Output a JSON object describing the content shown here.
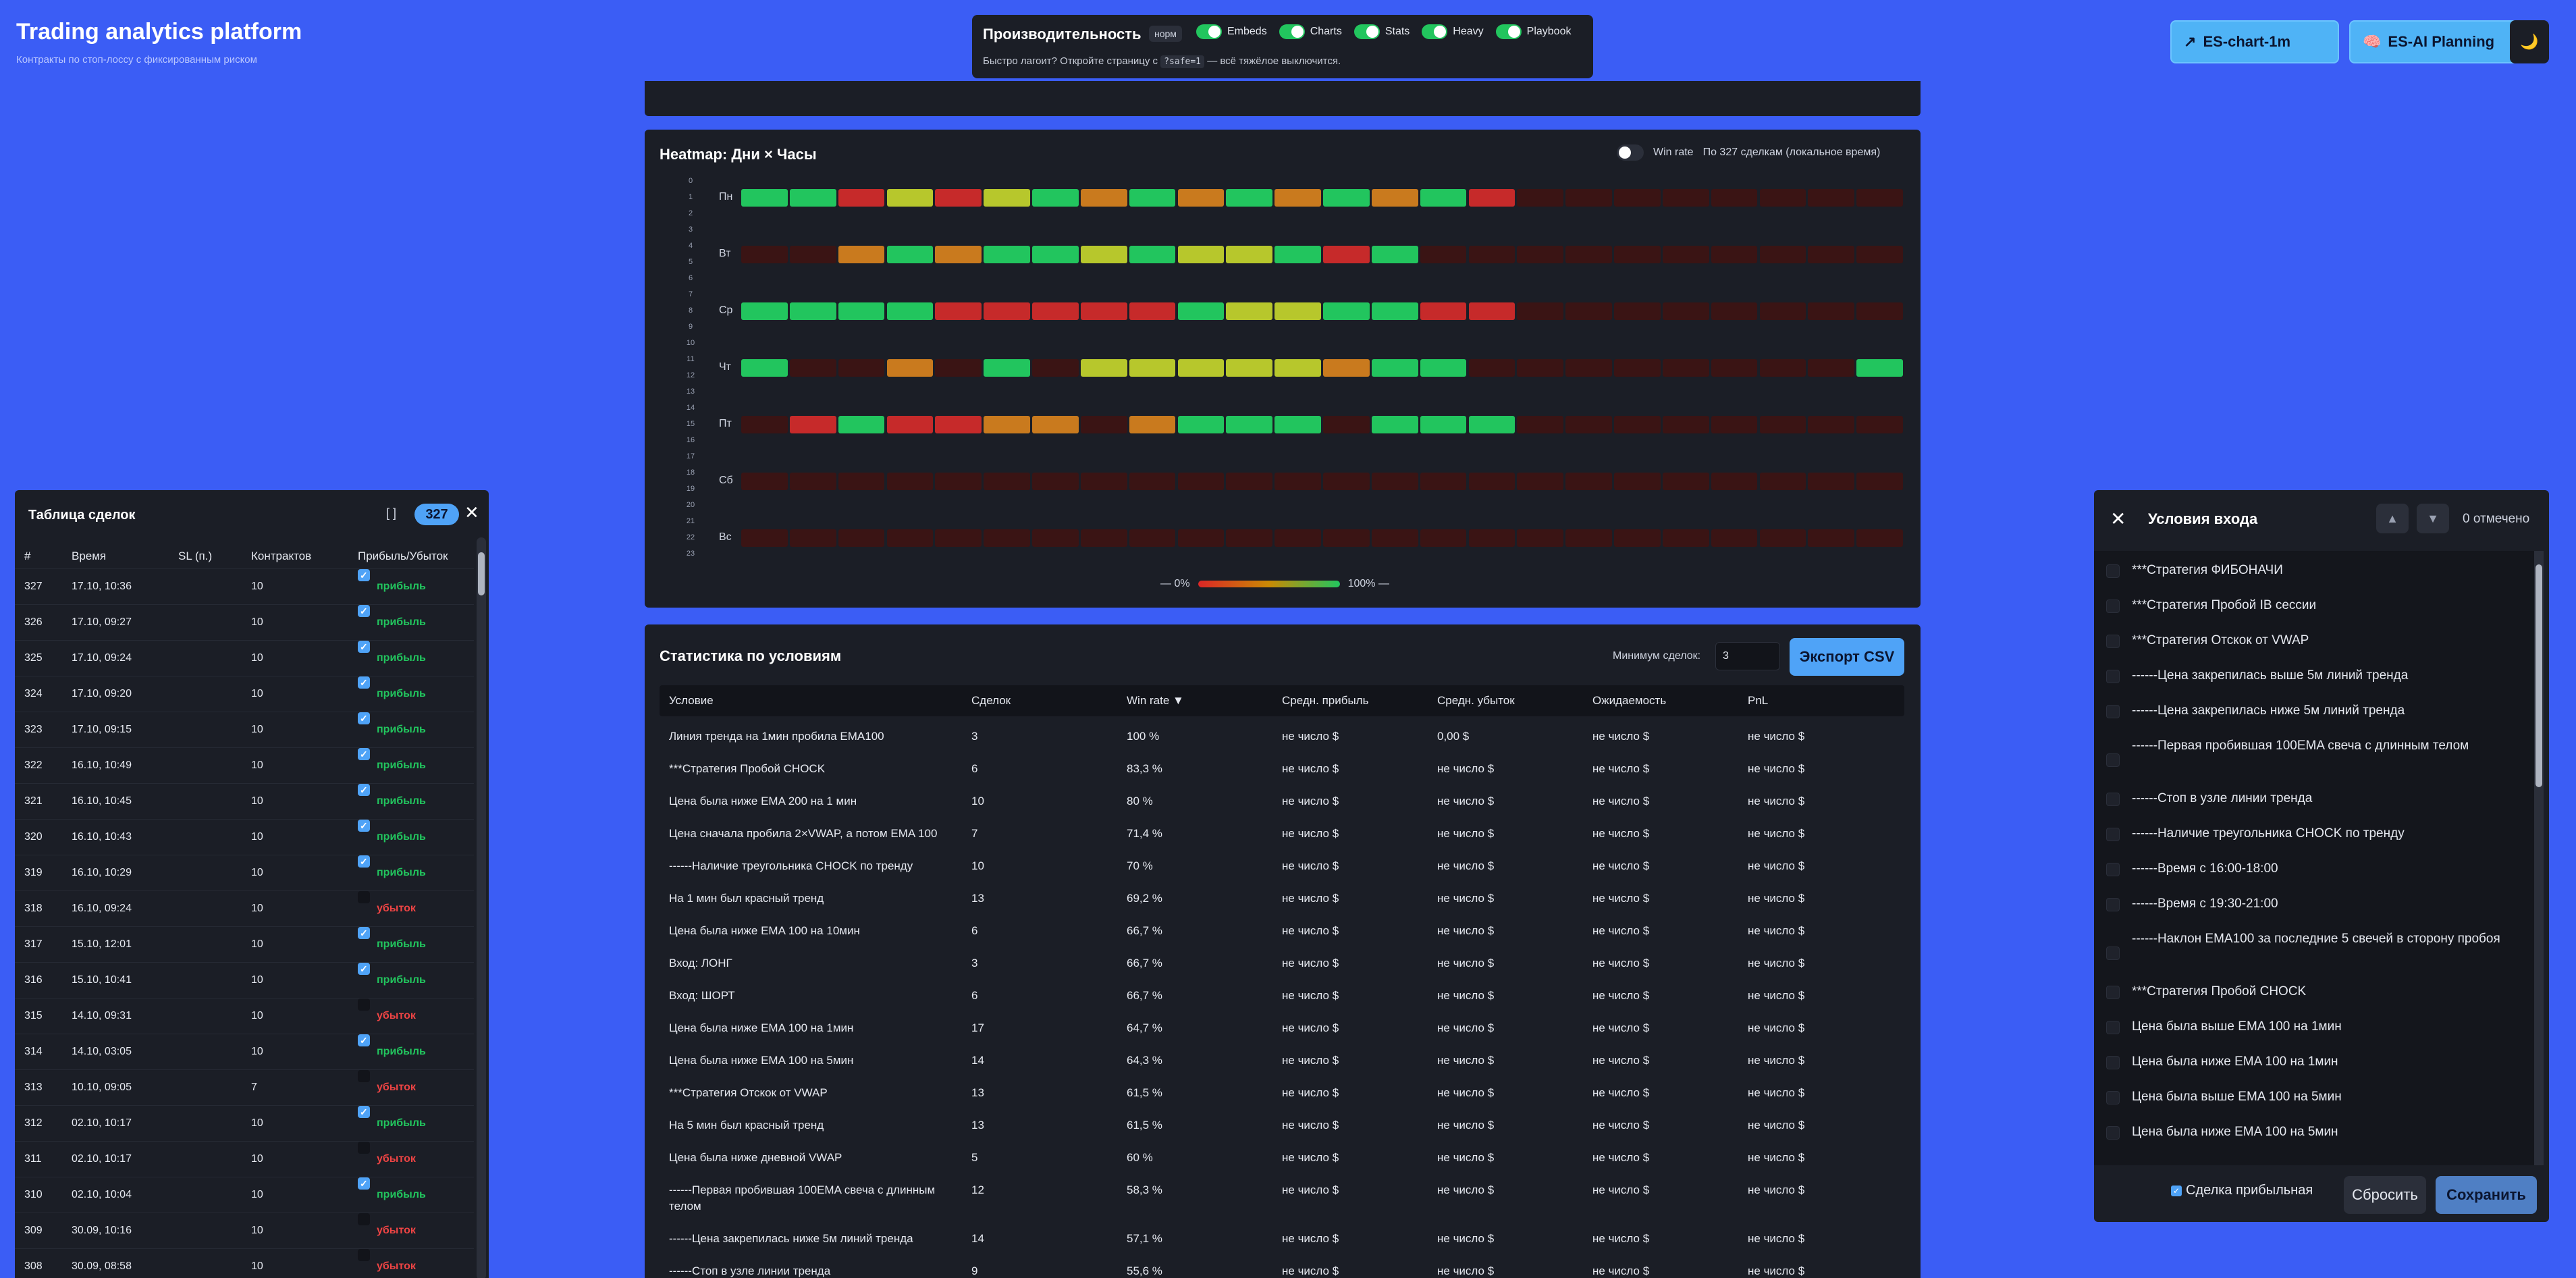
{
  "app": {
    "title": "Trading analytics platform",
    "subtitle": "Контракты по стоп-лоссу с фиксированным риском"
  },
  "perf": {
    "title": "Производительность",
    "badge": "норм",
    "toggles": [
      "Embeds",
      "Charts",
      "Stats",
      "Heavy",
      "Playbook"
    ],
    "hint_a": "Быстро лагоит? Откройте страницу с",
    "hint_code": "?safe=1",
    "hint_b": "— всё тяжёлое выключится."
  },
  "header_buttons": {
    "chart": "ES-chart-1m",
    "ai": "ES-AI Planning",
    "theme_icon": "🌙"
  },
  "colors": {
    "win": "#22c55e",
    "loss": "#ef4444",
    "accent": "#4fa3f7",
    "bg": "#3b5df5",
    "panel": "#1b1e26"
  },
  "heatmap": {
    "title": "Heatmap: Дни × Часы",
    "winrate_label": "Win rate",
    "trades_label": "По 327 сделкам (локальное время)",
    "hours": [
      "0",
      "1",
      "2",
      "3",
      "4",
      "5",
      "6",
      "7",
      "8",
      "9",
      "10",
      "11",
      "12",
      "13",
      "14",
      "15",
      "16",
      "17",
      "18",
      "19",
      "20",
      "21",
      "22",
      "23"
    ],
    "days": [
      "Пн",
      "Вт",
      "Ср",
      "Чт",
      "Пт",
      "Сб",
      "Вс"
    ],
    "cells": [
      "GGRYRYGOGOGOGOGR########",
      "##OGOGGYGYYGRG##########",
      "GGGGRRRRRGYYGGRR########",
      "G##O#G#YYYYYOGG########G",
      "#RGRROO#OGGG#GGG########",
      "########################",
      "########################"
    ],
    "legend_min": "0%",
    "legend_max": "100%"
  },
  "stats": {
    "title": "Статистика по условиям",
    "min_label": "Минимум сделок:",
    "min_value": "3",
    "export_label": "Экспорт CSV",
    "columns": [
      "Условие",
      "Сделок",
      "Win rate ▼",
      "Средн. прибыль",
      "Средн. убыток",
      "Ожидаемость",
      "PnL"
    ],
    "rows": [
      [
        "Линия тренда на 1мин пробила EMA100",
        "3",
        "100 %",
        "не число $",
        "0,00 $",
        "не число $",
        "не число $"
      ],
      [
        "***Стратегия Пробой CHOCK",
        "6",
        "83,3 %",
        "не число $",
        "не число $",
        "не число $",
        "не число $"
      ],
      [
        "Цена была ниже EMA 200 на 1 мин",
        "10",
        "80 %",
        "не число $",
        "не число $",
        "не число $",
        "не число $"
      ],
      [
        "Цена сначала пробила 2×VWAP, а потом EMA 100",
        "7",
        "71,4 %",
        "не число $",
        "не число $",
        "не число $",
        "не число $"
      ],
      [
        "------Наличие треугольника CHOCK по тренду",
        "10",
        "70 %",
        "не число $",
        "не число $",
        "не число $",
        "не число $"
      ],
      [
        "На 1 мин был красный тренд",
        "13",
        "69,2 %",
        "не число $",
        "не число $",
        "не число $",
        "не число $"
      ],
      [
        "Цена была ниже EMA 100 на 10мин",
        "6",
        "66,7 %",
        "не число $",
        "не число $",
        "не число $",
        "не число $"
      ],
      [
        "Вход: ЛОНГ",
        "3",
        "66,7 %",
        "не число $",
        "не число $",
        "не число $",
        "не число $"
      ],
      [
        "Вход: ШОРТ",
        "6",
        "66,7 %",
        "не число $",
        "не число $",
        "не число $",
        "не число $"
      ],
      [
        "Цена была ниже EMA 100 на 1мин",
        "17",
        "64,7 %",
        "не число $",
        "не число $",
        "не число $",
        "не число $"
      ],
      [
        "Цена была ниже EMA 100 на 5мин",
        "14",
        "64,3 %",
        "не число $",
        "не число $",
        "не число $",
        "не число $"
      ],
      [
        "***Стратегия Отскок от VWAP",
        "13",
        "61,5 %",
        "не число $",
        "не число $",
        "не число $",
        "не число $"
      ],
      [
        "На 5 мин был красный тренд",
        "13",
        "61,5 %",
        "не число $",
        "не число $",
        "не число $",
        "не число $"
      ],
      [
        "Цена была ниже дневной VWAP",
        "5",
        "60 %",
        "не число $",
        "не число $",
        "не число $",
        "не число $"
      ],
      [
        "------Первая пробившая 100EMA свеча с длинным телом",
        "12",
        "58,3 %",
        "не число $",
        "не число $",
        "не число $",
        "не число $"
      ],
      [
        "------Цена закрепилась ниже 5м линий тренда",
        "14",
        "57,1 %",
        "не число $",
        "не число $",
        "не число $",
        "не число $"
      ],
      [
        "------Стоп в узле линии тренда",
        "9",
        "55,6 %",
        "не число $",
        "не число $",
        "не число $",
        "не число $"
      ]
    ]
  },
  "trades": {
    "title": "Таблица сделок",
    "brackets": "[ ]",
    "count": "327",
    "columns": [
      "#",
      "Время",
      "SL (п.)",
      "Контрактов",
      "Прибыль/Убыток"
    ],
    "rows": [
      {
        "n": "327",
        "t": "17.10, 10:36",
        "sl": "",
        "c": "10",
        "w": true,
        "r": "прибыль"
      },
      {
        "n": "326",
        "t": "17.10, 09:27",
        "sl": "",
        "c": "10",
        "w": true,
        "r": "прибыль"
      },
      {
        "n": "325",
        "t": "17.10, 09:24",
        "sl": "",
        "c": "10",
        "w": true,
        "r": "прибыль"
      },
      {
        "n": "324",
        "t": "17.10, 09:20",
        "sl": "",
        "c": "10",
        "w": true,
        "r": "прибыль"
      },
      {
        "n": "323",
        "t": "17.10, 09:15",
        "sl": "",
        "c": "10",
        "w": true,
        "r": "прибыль"
      },
      {
        "n": "322",
        "t": "16.10, 10:49",
        "sl": "",
        "c": "10",
        "w": true,
        "r": "прибыль"
      },
      {
        "n": "321",
        "t": "16.10, 10:45",
        "sl": "",
        "c": "10",
        "w": true,
        "r": "прибыль"
      },
      {
        "n": "320",
        "t": "16.10, 10:43",
        "sl": "",
        "c": "10",
        "w": true,
        "r": "прибыль"
      },
      {
        "n": "319",
        "t": "16.10, 10:29",
        "sl": "",
        "c": "10",
        "w": true,
        "r": "прибыль"
      },
      {
        "n": "318",
        "t": "16.10, 09:24",
        "sl": "",
        "c": "10",
        "w": false,
        "r": "убыток"
      },
      {
        "n": "317",
        "t": "15.10, 12:01",
        "sl": "",
        "c": "10",
        "w": true,
        "r": "прибыль"
      },
      {
        "n": "316",
        "t": "15.10, 10:41",
        "sl": "",
        "c": "10",
        "w": true,
        "r": "прибыль"
      },
      {
        "n": "315",
        "t": "14.10, 09:31",
        "sl": "",
        "c": "10",
        "w": false,
        "r": "убыток"
      },
      {
        "n": "314",
        "t": "14.10, 03:05",
        "sl": "",
        "c": "10",
        "w": true,
        "r": "прибыль"
      },
      {
        "n": "313",
        "t": "10.10, 09:05",
        "sl": "",
        "c": "7",
        "w": false,
        "r": "убыток"
      },
      {
        "n": "312",
        "t": "02.10, 10:17",
        "sl": "",
        "c": "10",
        "w": true,
        "r": "прибыль"
      },
      {
        "n": "311",
        "t": "02.10, 10:17",
        "sl": "",
        "c": "10",
        "w": false,
        "r": "убыток"
      },
      {
        "n": "310",
        "t": "02.10, 10:04",
        "sl": "",
        "c": "10",
        "w": true,
        "r": "прибыль"
      },
      {
        "n": "309",
        "t": "30.09, 10:16",
        "sl": "",
        "c": "10",
        "w": false,
        "r": "убыток"
      },
      {
        "n": "308",
        "t": "30.09, 08:58",
        "sl": "",
        "c": "10",
        "w": false,
        "r": "убыток"
      }
    ]
  },
  "conditions": {
    "title": "Условия входа",
    "marked": "0 отмечено",
    "items": [
      "***Стратегия ФИБОНАЧИ",
      "***Стратегия Пробой IB сессии",
      "***Стратегия Отскок от VWAP",
      "------Цена закрепилась выше 5м линий тренда",
      "------Цена закрепилась ниже 5м линий тренда",
      "------Первая пробившая 100EMA свеча с длинным телом",
      "------Стоп в узле линии тренда",
      "------Наличие треугольника CHOCK по тренду",
      "------Время с 16:00-18:00",
      "------Время с 19:30-21:00",
      "------Наклон EMA100 за последние 5 свечей в сторону пробоя",
      "***Стратегия Пробой CHOCK",
      "Цена была выше EMA 100 на 1мин",
      "Цена была ниже EMA 100 на 1мин",
      "Цена была выше EMA 100 на 5мин",
      "Цена была ниже EMA 100 на 5мин"
    ],
    "profit_label": "Сделка прибыльная",
    "reset_label": "Сбросить",
    "save_label": "Сохранить"
  }
}
